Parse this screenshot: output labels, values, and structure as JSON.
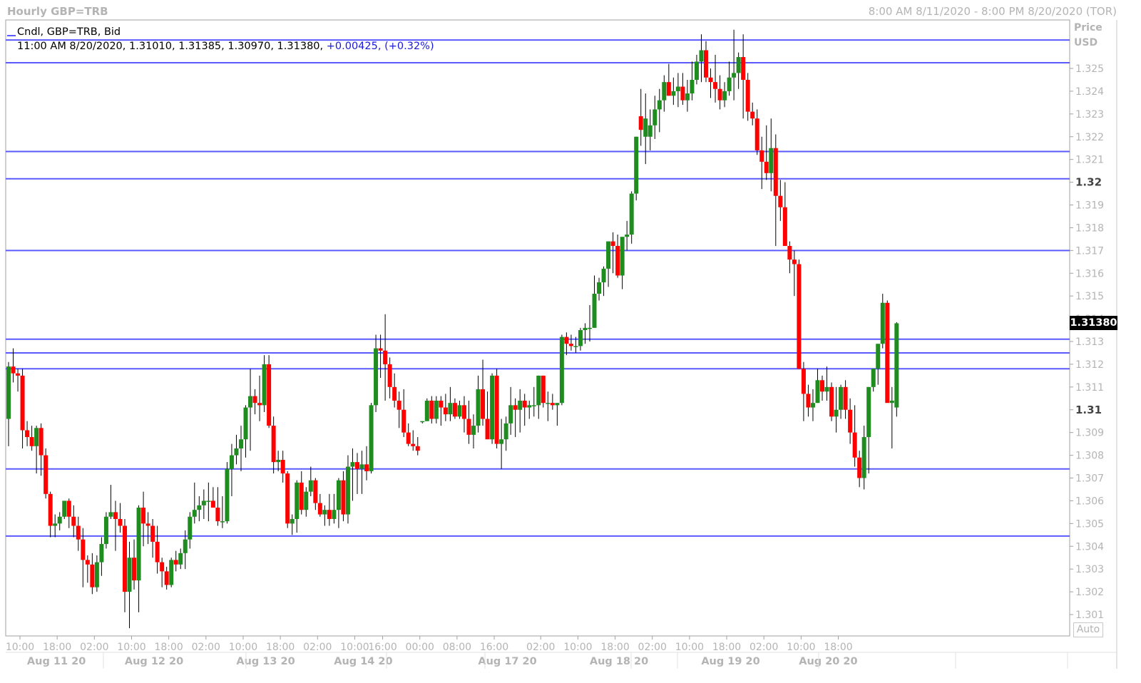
{
  "header": {
    "title": "Hourly GBP=TRB",
    "range": "8:00 AM 8/11/2020 - 8:00 PM 8/20/2020 (TOR)"
  },
  "info": {
    "line1": "Cndl, GBP=TRB, Bid",
    "time": "11:00 AM 8/20/2020,",
    "ohlc": "1.31010, 1.31385, 1.30970, 1.31380,",
    "change": "+0.00425,",
    "change_pct": "(+0.32%)"
  },
  "price_axis": {
    "label_line1": "Price",
    "label_line2": "USD",
    "auto_label": "Auto",
    "last_price": "1.31380"
  },
  "colors": {
    "up": "#1f8c1f",
    "down": "#ff0000",
    "hline": "#5a5aff",
    "grid": "#e8e8e8"
  },
  "chart_data": {
    "type": "candlestick",
    "title": "Hourly GBP=TRB",
    "ylabel": "Price USD",
    "ylim": [
      1.3005,
      1.3265
    ],
    "y_ticks": [
      "1.301",
      "1.302",
      "1.303",
      "1.304",
      "1.305",
      "1.306",
      "1.307",
      "1.308",
      "1.309",
      "1.31",
      "1.311",
      "1.312",
      "1.313",
      "1.314",
      "1.315",
      "1.316",
      "1.317",
      "1.318",
      "1.319",
      "1.32",
      "1.321",
      "1.322",
      "1.323",
      "1.324",
      "1.325"
    ],
    "y_ticks_bold": [
      "1.31",
      "1.32"
    ],
    "x_tick_labels": [
      "10:00",
      "18:00",
      "02:00",
      "10:00",
      "18:00",
      "02:00",
      "10:00",
      "18:00",
      "02:00",
      "10:00",
      "16:00",
      "00:00",
      "08:00",
      "16:00",
      "02:00",
      "10:00",
      "18:00",
      "02:00",
      "10:00",
      "18:00",
      "02:00",
      "10:00",
      "18:00"
    ],
    "x_tick_index": [
      0,
      8,
      16,
      24,
      32,
      40,
      48,
      56,
      64,
      72,
      78,
      86,
      94,
      102,
      112,
      120,
      128,
      136,
      144,
      152,
      160,
      168,
      176
    ],
    "date_labels": [
      "Aug 11 20",
      "Aug 12 20",
      "Aug 13 20",
      "Aug 14 20",
      "Aug 17 20",
      "Aug 18 20",
      "Aug 19 20",
      "Aug 20 20"
    ],
    "date_index": [
      6,
      27,
      51,
      72,
      103,
      127,
      151,
      172
    ],
    "horizontal_lines": [
      1.32625,
      1.32525,
      1.32135,
      1.32015,
      1.317,
      1.3131,
      1.3125,
      1.3118,
      1.3074,
      1.30445
    ],
    "last_price": 1.3138,
    "candles": [
      [
        1.3096,
        1.3121,
        1.3084,
        1.3119
      ],
      [
        1.3119,
        1.3127,
        1.3112,
        1.3116
      ],
      [
        1.3116,
        1.3118,
        1.3108,
        1.3115
      ],
      [
        1.3115,
        1.3118,
        1.3083,
        1.3091
      ],
      [
        1.3091,
        1.3095,
        1.3084,
        1.3088
      ],
      [
        1.3088,
        1.3093,
        1.3082,
        1.3084
      ],
      [
        1.3084,
        1.3093,
        1.3072,
        1.3092
      ],
      [
        1.3092,
        1.3094,
        1.3071,
        1.308
      ],
      [
        1.308,
        1.3083,
        1.3061,
        1.3063
      ],
      [
        1.3063,
        1.3064,
        1.3044,
        1.3049
      ],
      [
        1.3049,
        1.3054,
        1.3044,
        1.305
      ],
      [
        1.305,
        1.3055,
        1.3047,
        1.3053
      ],
      [
        1.3053,
        1.306,
        1.3052,
        1.306
      ],
      [
        1.306,
        1.3061,
        1.3048,
        1.3053
      ],
      [
        1.3053,
        1.3058,
        1.3044,
        1.3049
      ],
      [
        1.3049,
        1.3053,
        1.3038,
        1.3043
      ],
      [
        1.3043,
        1.3048,
        1.3022,
        1.3034
      ],
      [
        1.3034,
        1.3036,
        1.3024,
        1.3032
      ],
      [
        1.3032,
        1.3037,
        1.3019,
        1.3022
      ],
      [
        1.3022,
        1.3036,
        1.302,
        1.3033
      ],
      [
        1.3033,
        1.3044,
        1.3027,
        1.3041
      ],
      [
        1.3041,
        1.3055,
        1.3039,
        1.3053
      ],
      [
        1.3053,
        1.3067,
        1.3052,
        1.3055
      ],
      [
        1.3055,
        1.306,
        1.3038,
        1.3052
      ],
      [
        1.3052,
        1.3059,
        1.3046,
        1.3049
      ],
      [
        1.3049,
        1.3052,
        1.3011,
        1.302
      ],
      [
        1.302,
        1.3042,
        1.3004,
        1.3035
      ],
      [
        1.3035,
        1.3043,
        1.3021,
        1.3025
      ],
      [
        1.3025,
        1.3058,
        1.3011,
        1.3057
      ],
      [
        1.3057,
        1.3064,
        1.304,
        1.305
      ],
      [
        1.305,
        1.3055,
        1.3041,
        1.3049
      ],
      [
        1.3049,
        1.3052,
        1.3035,
        1.3042
      ],
      [
        1.3042,
        1.3049,
        1.3028,
        1.3033
      ],
      [
        1.3033,
        1.3035,
        1.3022,
        1.3029
      ],
      [
        1.3029,
        1.3031,
        1.3021,
        1.3023
      ],
      [
        1.3023,
        1.3035,
        1.3022,
        1.3034
      ],
      [
        1.3034,
        1.3038,
        1.3029,
        1.3032
      ],
      [
        1.3032,
        1.3039,
        1.303,
        1.3037
      ],
      [
        1.3037,
        1.3047,
        1.303,
        1.3043
      ],
      [
        1.3043,
        1.3055,
        1.3039,
        1.3053
      ],
      [
        1.3053,
        1.3068,
        1.305,
        1.3056
      ],
      [
        1.3056,
        1.3062,
        1.3051,
        1.3058
      ],
      [
        1.3058,
        1.3065,
        1.3052,
        1.306
      ],
      [
        1.306,
        1.3068,
        1.3051,
        1.306
      ],
      [
        1.306,
        1.3066,
        1.3057,
        1.3057
      ],
      [
        1.3057,
        1.3066,
        1.3049,
        1.3051
      ],
      [
        1.3051,
        1.3062,
        1.3048,
        1.3051
      ],
      [
        1.3051,
        1.3077,
        1.305,
        1.3074
      ],
      [
        1.3074,
        1.3085,
        1.3062,
        1.308
      ],
      [
        1.308,
        1.3089,
        1.3076,
        1.3083
      ],
      [
        1.3083,
        1.3093,
        1.3073,
        1.3087
      ],
      [
        1.3087,
        1.3102,
        1.3079,
        1.3101
      ],
      [
        1.3101,
        1.3118,
        1.3082,
        1.3106
      ],
      [
        1.3106,
        1.3109,
        1.3098,
        1.3103
      ],
      [
        1.3103,
        1.3115,
        1.3095,
        1.3102
      ],
      [
        1.3102,
        1.3124,
        1.3099,
        1.312
      ],
      [
        1.312,
        1.3124,
        1.3092,
        1.3093
      ],
      [
        1.3093,
        1.3097,
        1.3072,
        1.3077
      ],
      [
        1.3077,
        1.3082,
        1.3073,
        1.3078
      ],
      [
        1.3078,
        1.3082,
        1.3068,
        1.3072
      ],
      [
        1.3072,
        1.3073,
        1.3048,
        1.305
      ],
      [
        1.305,
        1.3054,
        1.3045,
        1.3052
      ],
      [
        1.3052,
        1.3069,
        1.3046,
        1.3068
      ],
      [
        1.3068,
        1.3073,
        1.3054,
        1.3056
      ],
      [
        1.3056,
        1.3066,
        1.3053,
        1.3064
      ],
      [
        1.3064,
        1.3075,
        1.3062,
        1.3069
      ],
      [
        1.3069,
        1.307,
        1.3056,
        1.3059
      ],
      [
        1.3059,
        1.3063,
        1.3053,
        1.3054
      ],
      [
        1.3054,
        1.3058,
        1.3049,
        1.3056
      ],
      [
        1.3056,
        1.3063,
        1.3049,
        1.3052
      ],
      [
        1.3052,
        1.3063,
        1.305,
        1.3056
      ],
      [
        1.3056,
        1.307,
        1.3048,
        1.3069
      ],
      [
        1.3069,
        1.3073,
        1.3051,
        1.3054
      ],
      [
        1.3054,
        1.308,
        1.305,
        1.3075
      ],
      [
        1.3075,
        1.3083,
        1.306,
        1.3077
      ],
      [
        1.3077,
        1.3081,
        1.3063,
        1.3074
      ],
      [
        1.3074,
        1.3082,
        1.3063,
        1.3076
      ],
      [
        1.3076,
        1.3084,
        1.3069,
        1.3073
      ],
      [
        1.3073,
        1.3103,
        1.3072,
        1.3102
      ],
      [
        1.3102,
        1.3133,
        1.3099,
        1.3127
      ],
      [
        1.3127,
        1.3133,
        1.3114,
        1.3126
      ],
      [
        1.3126,
        1.3142,
        1.3104,
        1.312
      ],
      [
        1.312,
        1.3123,
        1.3105,
        1.311
      ],
      [
        1.311,
        1.3116,
        1.3101,
        1.3104
      ],
      [
        1.3104,
        1.3108,
        1.3092,
        1.31
      ],
      [
        1.31,
        1.3109,
        1.3088,
        1.309
      ],
      [
        1.309,
        1.3094,
        1.3084,
        1.3085
      ],
      [
        1.3085,
        1.3091,
        1.3082,
        1.3084
      ],
      [
        1.3084,
        1.3088,
        1.308,
        1.3082
      ],
      [
        1.3095,
        1.3095,
        1.3094,
        1.3095
      ],
      [
        1.3095,
        1.3105,
        1.3095,
        1.3104
      ],
      [
        1.3104,
        1.3106,
        1.3094,
        1.3096
      ],
      [
        1.3096,
        1.3106,
        1.3094,
        1.3104
      ],
      [
        1.3104,
        1.3106,
        1.3093,
        1.3101
      ],
      [
        1.3101,
        1.3107,
        1.3095,
        1.3098
      ],
      [
        1.3098,
        1.311,
        1.3095,
        1.3103
      ],
      [
        1.3103,
        1.3105,
        1.3096,
        1.3097
      ],
      [
        1.3097,
        1.3104,
        1.3096,
        1.3102
      ],
      [
        1.3102,
        1.3106,
        1.309,
        1.3096
      ],
      [
        1.3096,
        1.3104,
        1.3085,
        1.3089
      ],
      [
        1.3089,
        1.3098,
        1.3083,
        1.3093
      ],
      [
        1.3093,
        1.3115,
        1.309,
        1.3109
      ],
      [
        1.3109,
        1.3122,
        1.3093,
        1.3096
      ],
      [
        1.3096,
        1.3108,
        1.3088,
        1.3087
      ],
      [
        1.3087,
        1.3116,
        1.3085,
        1.3115
      ],
      [
        1.3115,
        1.3118,
        1.3083,
        1.3085
      ],
      [
        1.3085,
        1.3096,
        1.3074,
        1.3087
      ],
      [
        1.3087,
        1.3097,
        1.3082,
        1.3094
      ],
      [
        1.3094,
        1.311,
        1.3089,
        1.3102
      ],
      [
        1.3102,
        1.3105,
        1.3088,
        1.31
      ],
      [
        1.31,
        1.3109,
        1.309,
        1.3104
      ],
      [
        1.3104,
        1.3107,
        1.3093,
        1.3101
      ],
      [
        1.3101,
        1.3104,
        1.3096,
        1.3102
      ],
      [
        1.3102,
        1.311,
        1.3097,
        1.3102
      ],
      [
        1.3102,
        1.3115,
        1.3096,
        1.3115
      ],
      [
        1.3115,
        1.3115,
        1.3101,
        1.3103
      ],
      [
        1.3103,
        1.3108,
        1.3095,
        1.3103
      ],
      [
        1.3103,
        1.3107,
        1.31,
        1.3102
      ],
      [
        1.3102,
        1.3103,
        1.3093,
        1.3103
      ],
      [
        1.3103,
        1.3133,
        1.3102,
        1.3132
      ],
      [
        1.3132,
        1.3134,
        1.3124,
        1.3129
      ],
      [
        1.3129,
        1.3133,
        1.3126,
        1.3128
      ],
      [
        1.3128,
        1.3132,
        1.3125,
        1.3128
      ],
      [
        1.3128,
        1.3136,
        1.3126,
        1.3135
      ],
      [
        1.3135,
        1.3138,
        1.3129,
        1.3136
      ],
      [
        1.3136,
        1.3146,
        1.313,
        1.3136
      ],
      [
        1.3136,
        1.3159,
        1.3136,
        1.3151
      ],
      [
        1.3151,
        1.3158,
        1.3148,
        1.3156
      ],
      [
        1.3156,
        1.3163,
        1.315,
        1.3162
      ],
      [
        1.3162,
        1.3174,
        1.3154,
        1.3174
      ],
      [
        1.3174,
        1.3178,
        1.316,
        1.3172
      ],
      [
        1.3172,
        1.3177,
        1.3158,
        1.3159
      ],
      [
        1.3159,
        1.3173,
        1.3153,
        1.3176
      ],
      [
        1.3176,
        1.3183,
        1.317,
        1.3177
      ],
      [
        1.3177,
        1.3196,
        1.3173,
        1.3195
      ],
      [
        1.3195,
        1.322,
        1.3192,
        1.322
      ],
      [
        1.3229,
        1.3241,
        1.3216,
        1.3223
      ],
      [
        1.322,
        1.3239,
        1.3208,
        1.3228
      ],
      [
        1.322,
        1.3232,
        1.3214,
        1.3225
      ],
      [
        1.3225,
        1.3238,
        1.3219,
        1.3232
      ],
      [
        1.3232,
        1.3241,
        1.3222,
        1.3236
      ],
      [
        1.3236,
        1.3247,
        1.3231,
        1.3244
      ],
      [
        1.3244,
        1.3252,
        1.3238,
        1.3238
      ],
      [
        1.3238,
        1.3246,
        1.3234,
        1.324
      ],
      [
        1.324,
        1.3248,
        1.3233,
        1.3242
      ],
      [
        1.3242,
        1.3248,
        1.3234,
        1.3236
      ],
      [
        1.3236,
        1.3245,
        1.3231,
        1.3239
      ],
      [
        1.3239,
        1.3253,
        1.3236,
        1.3245
      ],
      [
        1.3245,
        1.3256,
        1.3243,
        1.3253
      ],
      [
        1.3253,
        1.3265,
        1.3244,
        1.3258
      ],
      [
        1.3258,
        1.3262,
        1.3244,
        1.3246
      ],
      [
        1.3246,
        1.325,
        1.3237,
        1.3244
      ],
      [
        1.3244,
        1.3256,
        1.3235,
        1.3241
      ],
      [
        1.3241,
        1.3247,
        1.3232,
        1.3236
      ],
      [
        1.3236,
        1.3244,
        1.3233,
        1.324
      ],
      [
        1.324,
        1.3253,
        1.3238,
        1.3246
      ],
      [
        1.3246,
        1.3267,
        1.3236,
        1.3248
      ],
      [
        1.3248,
        1.3257,
        1.3241,
        1.3255
      ],
      [
        1.3255,
        1.3265,
        1.3228,
        1.3245
      ],
      [
        1.3245,
        1.3248,
        1.3227,
        1.3231
      ],
      [
        1.3231,
        1.3235,
        1.3225,
        1.3228
      ],
      [
        1.3228,
        1.3232,
        1.3212,
        1.3214
      ],
      [
        1.3214,
        1.322,
        1.3197,
        1.3209
      ],
      [
        1.3209,
        1.3225,
        1.3201,
        1.3204
      ],
      [
        1.3204,
        1.3228,
        1.3196,
        1.3215
      ],
      [
        1.3215,
        1.3221,
        1.3172,
        1.3194
      ],
      [
        1.3194,
        1.3201,
        1.3183,
        1.3189
      ],
      [
        1.3189,
        1.32,
        1.3176,
        1.3172
      ],
      [
        1.3172,
        1.3174,
        1.316,
        1.3166
      ],
      [
        1.3166,
        1.317,
        1.315,
        1.3164
      ],
      [
        1.3164,
        1.3166,
        1.3118,
        1.3118
      ],
      [
        1.3118,
        1.3121,
        1.3095,
        1.3107
      ],
      [
        1.3107,
        1.3111,
        1.3097,
        1.3101
      ],
      [
        1.3101,
        1.3109,
        1.3095,
        1.3103
      ],
      [
        1.3103,
        1.3118,
        1.3103,
        1.3113
      ],
      [
        1.3113,
        1.3115,
        1.3104,
        1.3108
      ],
      [
        1.3108,
        1.3119,
        1.3104,
        1.311
      ],
      [
        1.311,
        1.3112,
        1.3095,
        1.3097
      ],
      [
        1.3097,
        1.311,
        1.309,
        1.31
      ],
      [
        1.31,
        1.3111,
        1.3096,
        1.311
      ],
      [
        1.311,
        1.3113,
        1.3096,
        1.31
      ],
      [
        1.31,
        1.3105,
        1.3085,
        1.309
      ],
      [
        1.309,
        1.3102,
        1.3075,
        1.3079
      ],
      [
        1.3079,
        1.3082,
        1.3066,
        1.307
      ],
      [
        1.307,
        1.3093,
        1.3065,
        1.3088
      ],
      [
        1.3088,
        1.311,
        1.3072,
        1.311
      ],
      [
        1.311,
        1.3118,
        1.3108,
        1.3118
      ],
      [
        1.3118,
        1.3128,
        1.3111,
        1.3129
      ],
      [
        1.3129,
        1.3151,
        1.3127,
        1.3147
      ],
      [
        1.3147,
        1.3148,
        1.3104,
        1.3103
      ],
      [
        1.3103,
        1.311,
        1.3083,
        1.3104
      ],
      [
        1.3101,
        1.31385,
        1.3097,
        1.3138
      ]
    ]
  }
}
